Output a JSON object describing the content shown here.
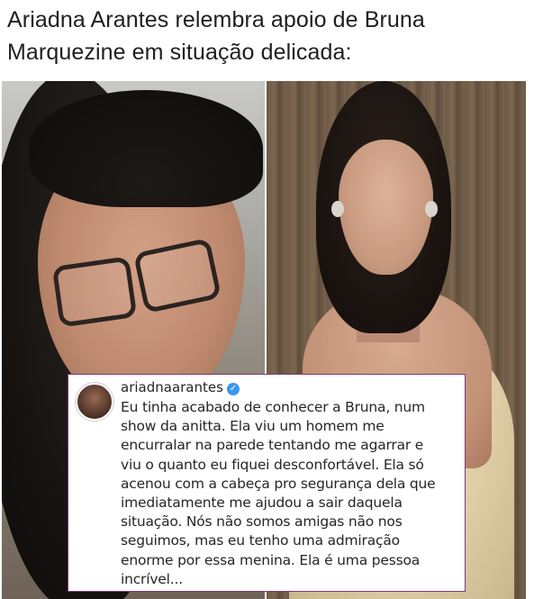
{
  "headline": {
    "line1": "Ariadna Arantes relembra apoio de Bruna",
    "line2": "Marquezine em situação delicada:"
  },
  "post": {
    "username": "ariadnaarantes",
    "verified_icon": "verified-badge-icon",
    "verified_color": "#3897f0",
    "caption": "Eu tinha acabado de conhecer a Bruna, num\nshow da anitta. Ela viu um homem me\nencurralar na parede tentando me agarrar e\nviu o quanto eu fiquei desconfortável. Ela só\nacenou com a cabeça pro segurança dela que\nimediatamente me ajudou a sair daquela\nsituação. Nós não somos amigas não nos\nseguimos, mas eu tenho uma admiração\nenorme por essa menina. Ela é uma pessoa\nincrível..."
  },
  "colors": {
    "card_border": "#7a3a74",
    "text": "#262626"
  }
}
